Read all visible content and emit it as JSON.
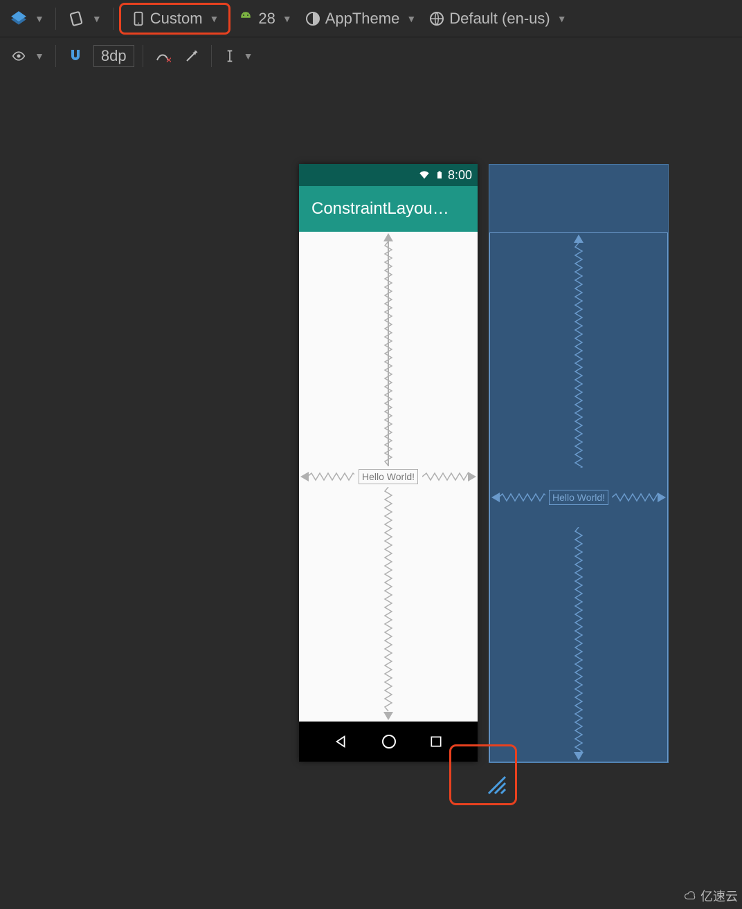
{
  "toolbar1": {
    "device_label": "Custom",
    "api_label": "28",
    "theme_label": "AppTheme",
    "locale_label": "Default (en-us)"
  },
  "toolbar2": {
    "grid_label": "8dp"
  },
  "preview": {
    "status_time": "8:00",
    "appbar_title": "ConstraintLayou…",
    "textview_text": "Hello World!"
  },
  "blueprint": {
    "textview_text": "Hello World!"
  },
  "watermark": "亿速云"
}
